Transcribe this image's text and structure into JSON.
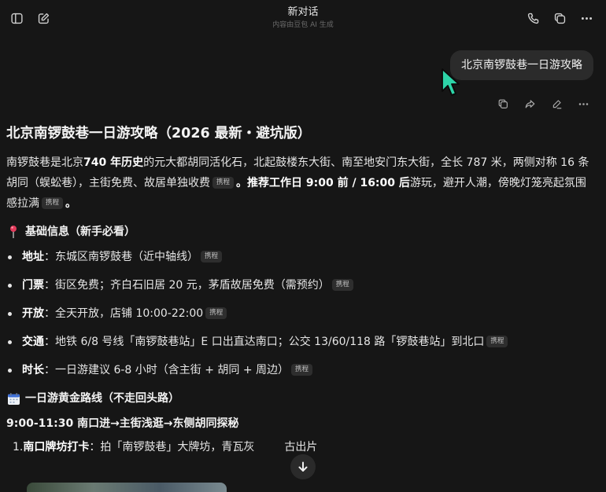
{
  "header": {
    "title": "新对话",
    "subtitle": "内容由豆包 AI 生成"
  },
  "user_message": "北京南锣鼓巷一日游攻略",
  "answer": {
    "title": "北京南锣鼓巷一日游攻略（2026 最新・避坑版）",
    "intro": {
      "p1": "南锣鼓巷是北京",
      "p1_bold": "740 年历史",
      "p2": "的元大都胡同活化石，北起鼓楼东大街、南至地安门东大街，全长 787 米，两侧对称 16 条胡同（蜈蚣巷），主街免费、故居单独收费",
      "tag1": "携程",
      "p3_bold": "。推荐工作日 9:00 前 / 16:00 后",
      "p4": "游玩，避开人潮，傍晚灯笼亮起氛围感拉满",
      "tag2": "携程",
      "p5": "。"
    },
    "basic_section": {
      "heading": "基础信息（新手必看）",
      "items": [
        {
          "label": "地址",
          "text": "：东城区南锣鼓巷（近中轴线）",
          "tag": "携程"
        },
        {
          "label": "门票",
          "text": "：街区免费；齐白石旧居 20 元，茅盾故居免费（需预约）",
          "tag": "携程"
        },
        {
          "label": "开放",
          "text": "：全天开放，店铺 10:00-22:00",
          "tag": "携程"
        },
        {
          "label": "交通",
          "text": "：地铁 6/8 号线「南锣鼓巷站」E 口出直达南口；公交 13/60/118 路「锣鼓巷站」到北口",
          "tag": "携程"
        },
        {
          "label": "时长",
          "text": "：一日游建议 6-8 小时（含主街 + 胡同 + 周边）",
          "tag": "携程"
        }
      ]
    },
    "route_section": {
      "heading": "一日游黄金路线（不走回头路）",
      "time_heading": "9:00-11:30 南口进→主街浅逛→东侧胡同探秘",
      "step1_num": "1.",
      "step1_label": "南口牌坊打卡",
      "step1_text": "：拍「南锣鼓巷」大牌坊，青瓦灰",
      "step1_tail": "古出片"
    }
  }
}
